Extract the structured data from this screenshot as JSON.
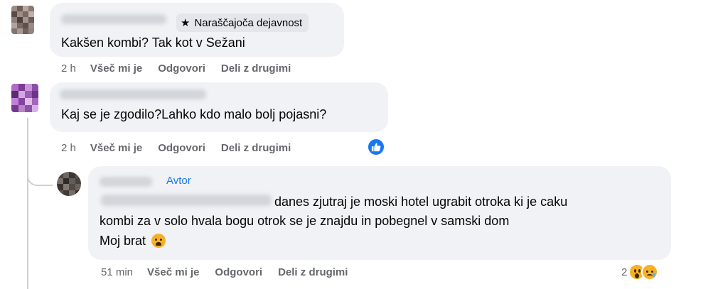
{
  "comments": [
    {
      "badge_label": "Naraščajoča dejavnost",
      "badge_icon": "star-icon",
      "text": "Kakšen kombi? Tak kot v Sežani",
      "time": "2 h",
      "like": "Všeč mi je",
      "reply": "Odgovori",
      "share": "Deli z drugimi"
    },
    {
      "text": "Kaj se je zgodilo?Lahko kdo malo bolj pojasni?",
      "time": "2 h",
      "like": "Všeč mi je",
      "reply": "Odgovori",
      "share": "Deli z drugimi",
      "reaction_icon": "like-icon"
    },
    {
      "author_tag": "Avtor",
      "line1": "danes zjutraj je moski hotel ugrabit otroka ki je caku",
      "line2": "kombi za v solo hvala bogu otrok se je znajdu in pobegnel v samski dom",
      "line3": "Moj brat",
      "emoji_icon": "crying-face-icon",
      "time": "51 min",
      "like": "Všeč mi je",
      "reply": "Odgovori",
      "share": "Deli z drugimi",
      "reaction_count": "2",
      "reaction_icons": [
        "wow-icon",
        "sad-icon"
      ]
    }
  ],
  "colors": {
    "bubble": "#f0f2f5",
    "meta_text": "#65676b",
    "accent": "#1877f2",
    "badge_bg": "#e4e6eb"
  }
}
